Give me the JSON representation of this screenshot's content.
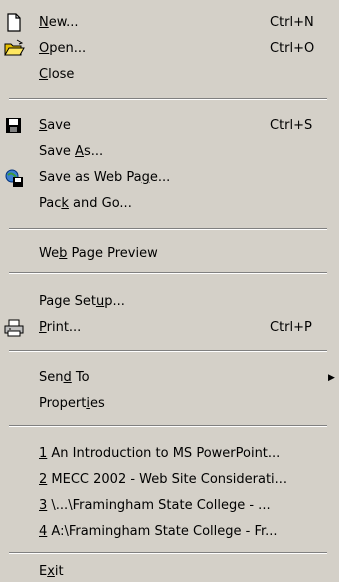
{
  "items": [
    {
      "name": "new",
      "pre": "",
      "ul": "N",
      "post": "ew...",
      "shortcut": "Ctrl+N"
    },
    {
      "name": "open",
      "pre": "",
      "ul": "O",
      "post": "pen...",
      "shortcut": "Ctrl+O"
    },
    {
      "name": "close",
      "pre": "",
      "ul": "C",
      "post": "lose",
      "shortcut": ""
    },
    {
      "name": "save",
      "pre": "",
      "ul": "S",
      "post": "ave",
      "shortcut": "Ctrl+S"
    },
    {
      "name": "save-as",
      "pre": "Save ",
      "ul": "A",
      "post": "s...",
      "shortcut": ""
    },
    {
      "name": "save-as-web-page",
      "pre": "Save as Web Pa",
      "ul": "g",
      "post": "e...",
      "shortcut": ""
    },
    {
      "name": "pack-and-go",
      "pre": "Pac",
      "ul": "k",
      "post": " and Go...",
      "shortcut": ""
    },
    {
      "name": "web-page-preview",
      "pre": "We",
      "ul": "b",
      "post": " Page Preview",
      "shortcut": ""
    },
    {
      "name": "page-setup",
      "pre": "Page Set",
      "ul": "u",
      "post": "p...",
      "shortcut": ""
    },
    {
      "name": "print",
      "pre": "",
      "ul": "P",
      "post": "rint...",
      "shortcut": "Ctrl+P"
    },
    {
      "name": "send-to",
      "pre": "Sen",
      "ul": "d",
      "post": " To",
      "shortcut": ""
    },
    {
      "name": "properties",
      "pre": "Propert",
      "ul": "i",
      "post": "es",
      "shortcut": ""
    },
    {
      "name": "recent-file-1",
      "pre": "",
      "ul": "1",
      "post": " An Introduction to MS PowerPoint...",
      "shortcut": ""
    },
    {
      "name": "recent-file-2",
      "pre": "",
      "ul": "2",
      "post": " MECC 2002 - Web Site Considerati...",
      "shortcut": ""
    },
    {
      "name": "recent-file-3",
      "pre": "",
      "ul": "3",
      "post": " \\...\\Framingham State College - ...",
      "shortcut": ""
    },
    {
      "name": "recent-file-4",
      "pre": "",
      "ul": "4",
      "post": " A:\\Framingham State College - Fr...",
      "shortcut": ""
    },
    {
      "name": "exit",
      "pre": "E",
      "ul": "x",
      "post": "it",
      "shortcut": ""
    }
  ],
  "icons": {
    "new": "new-document-icon",
    "open": "open-folder-icon",
    "save": "floppy-disk-icon",
    "save_as_web_page": "web-page-save-icon",
    "print": "printer-icon",
    "send_to": "submenu-arrow-icon"
  },
  "colors": {
    "menu_background": "#d4d0c8",
    "separator_dark": "#808080",
    "separator_light": "#ffffff"
  }
}
